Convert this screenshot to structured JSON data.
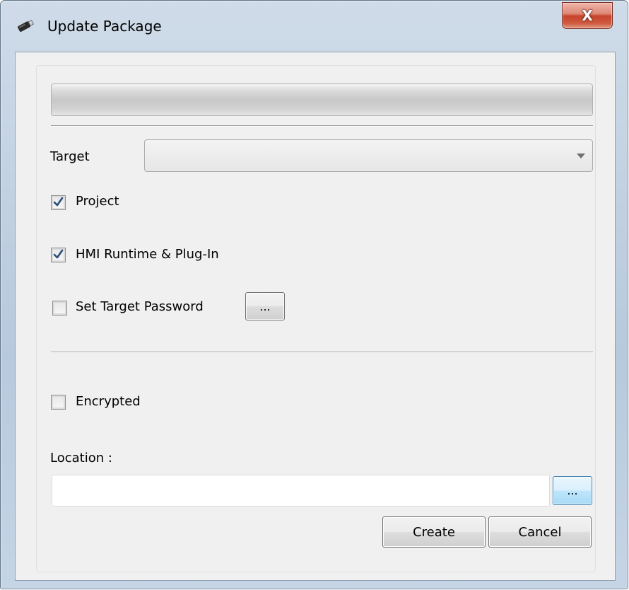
{
  "window": {
    "title": "Update Package",
    "close_label": "X"
  },
  "form": {
    "target_label": "Target",
    "target_value": "",
    "project_label": "Project",
    "project_checked": true,
    "hmi_label": "HMI Runtime & Plug-In",
    "hmi_checked": true,
    "password_label": "Set Target Password",
    "password_checked": false,
    "password_browse_label": "...",
    "encrypted_label": "Encrypted",
    "encrypted_checked": false,
    "location_label": "Location :",
    "location_value": "",
    "location_browse_label": "..."
  },
  "buttons": {
    "create": "Create",
    "cancel": "Cancel"
  },
  "progress": {
    "value": 0
  }
}
